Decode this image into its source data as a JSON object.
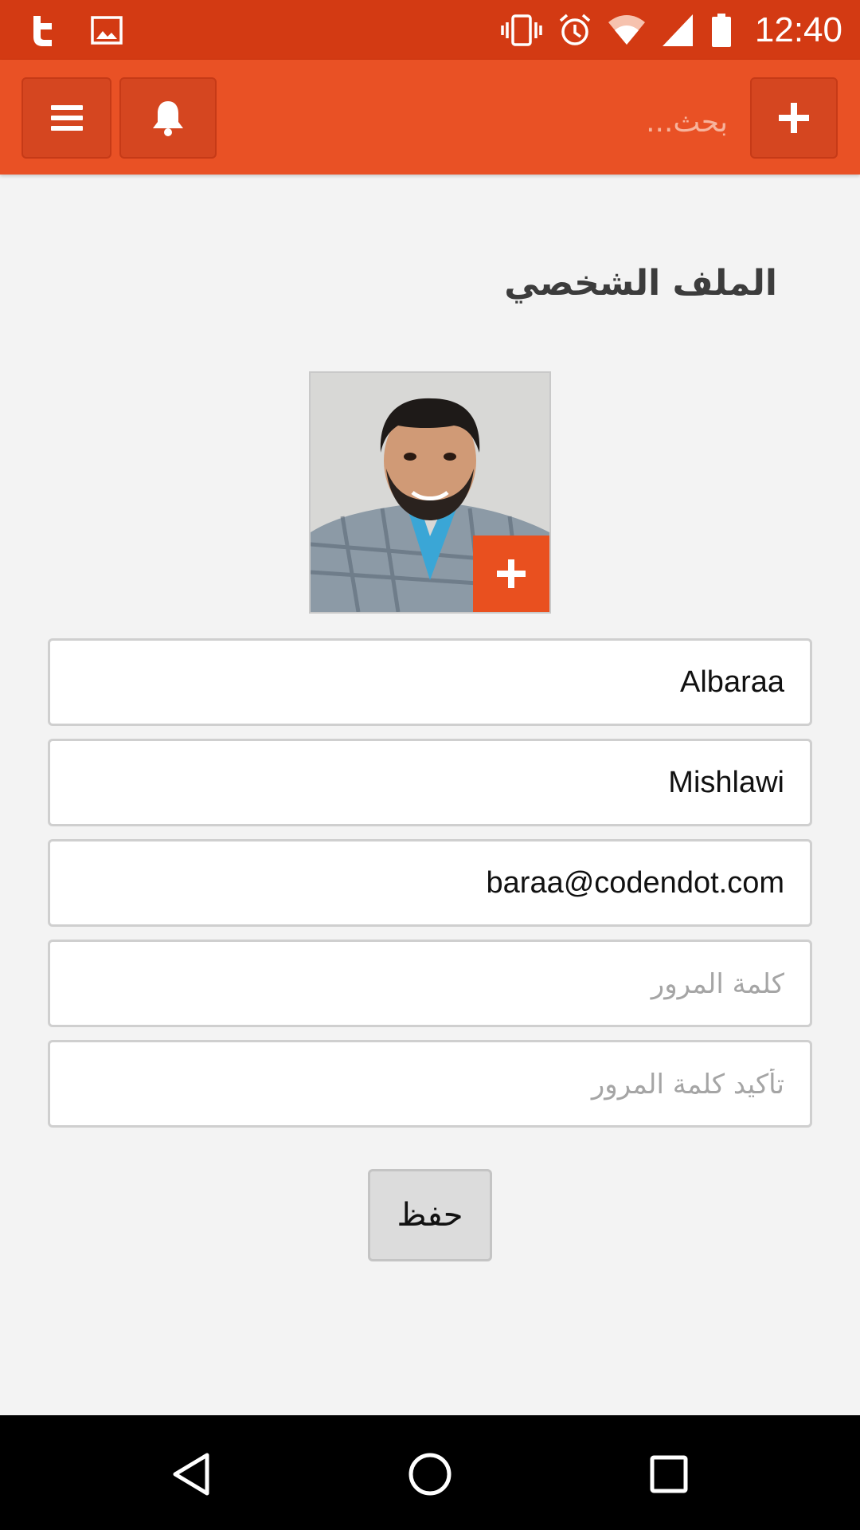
{
  "status_bar": {
    "time": "12:40",
    "left_icons": [
      "twitter-icon",
      "image-icon"
    ],
    "right_icons": [
      "vibrate-icon",
      "alarm-icon",
      "wifi-icon",
      "cell-signal-icon",
      "battery-icon"
    ]
  },
  "app_bar": {
    "search_placeholder": "بحث...",
    "buttons": [
      "menu-icon",
      "bell-icon",
      "plus-icon"
    ],
    "colors": {
      "background": "#e95125",
      "button": "#d54620"
    }
  },
  "page": {
    "title": "الملف الشخصي"
  },
  "form": {
    "first_name": "Albaraa",
    "last_name": "Mishlawi",
    "email": "baraa@codendot.com",
    "password_placeholder": "كلمة المرور",
    "confirm_password_placeholder": "تأكيد كلمة المرور",
    "save_label": "حفظ"
  },
  "nav_bar": {
    "buttons": [
      "back-icon",
      "home-icon",
      "recents-icon"
    ]
  }
}
